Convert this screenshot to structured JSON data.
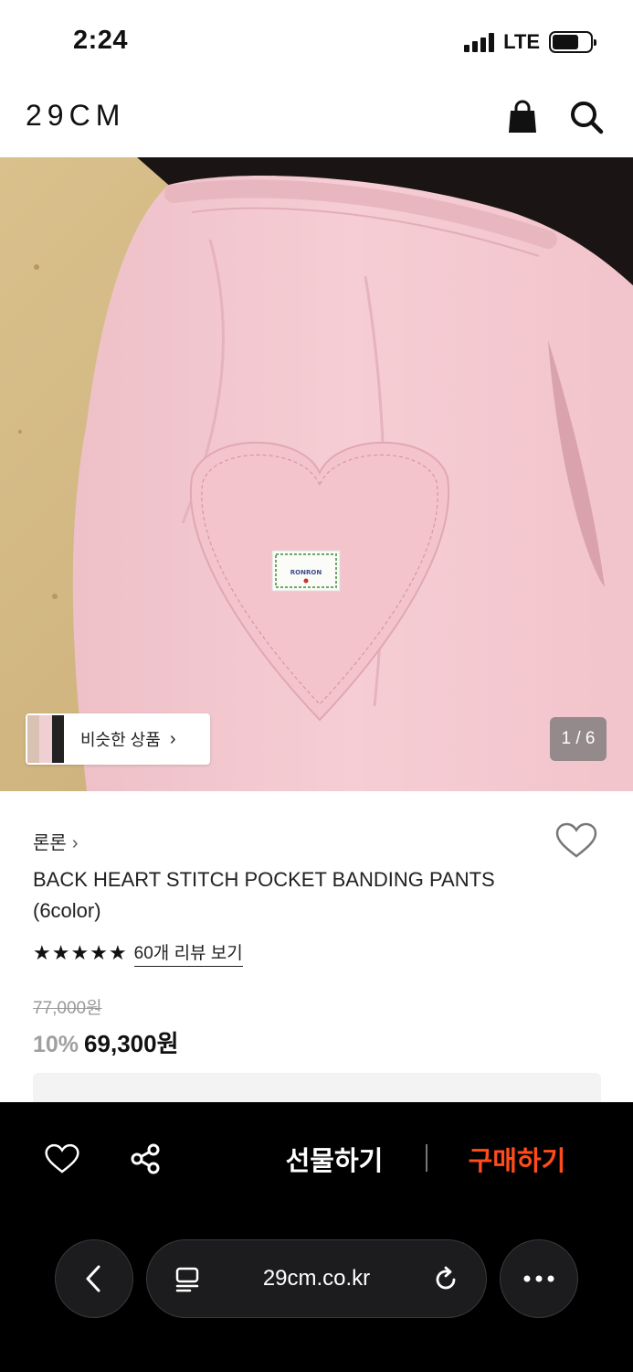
{
  "status_bar": {
    "time": "2:24",
    "network": "LTE"
  },
  "header": {
    "logo": "29CM"
  },
  "hero": {
    "similar_label": "비슷한 상품",
    "similar_arrow": "›",
    "pager": "1 / 6",
    "label_text": "RONRON"
  },
  "product": {
    "brand": "론론",
    "brand_chevron": "›",
    "title": "BACK HEART STITCH POCKET BANDING PANTS (6color)",
    "stars": [
      "★",
      "★",
      "★",
      "★",
      "★"
    ],
    "review_link": "60개 리뷰 보기",
    "original_price": "77,000원",
    "discount": "10%",
    "sale_price": "69,300원"
  },
  "action_bar": {
    "gift_label": "선물하기",
    "buy_label": "구매하기"
  },
  "browser": {
    "url": "29cm.co.kr"
  },
  "colors": {
    "buy_accent": "#ff4c1a",
    "pants_pink": "#f3c6cd"
  }
}
